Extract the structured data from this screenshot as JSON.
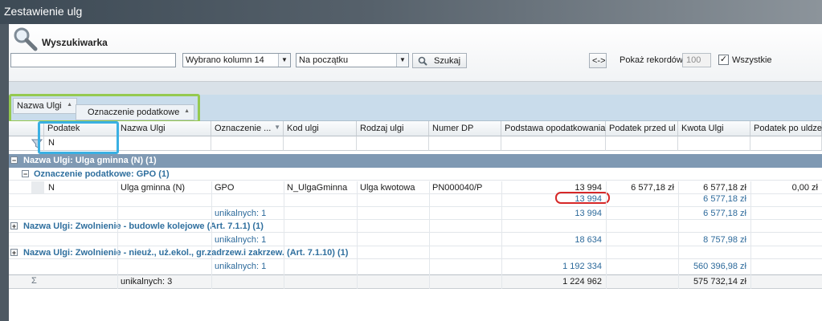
{
  "window": {
    "title": "Zestawienie ulg"
  },
  "search": {
    "panel_title": "Wyszukiwarka",
    "query": "",
    "columns_combo": "Wybrano kolumn 14",
    "mode_combo": "Na początku",
    "search_button": "Szukaj",
    "swap_button": "<->",
    "records_label": "Pokaż rekordów",
    "records_value": "100",
    "all_checked": true,
    "all_label": "Wszystkie"
  },
  "group_by": [
    "Nazwa Ulgi",
    "Oznaczenie podatkowe"
  ],
  "columns": [
    "Podatek",
    "Nazwa Ulgi",
    "Oznaczenie ...",
    "Kod ulgi",
    "Rodzaj ulgi",
    "Numer DP",
    "Podstawa opodatkowania",
    "Podatek przed ul",
    "Kwota Ulgi",
    "Podatek po uldze"
  ],
  "filter": {
    "podatek": "N"
  },
  "groups": [
    {
      "header": "Nazwa Ulgi:  Ulga gminna (N)  (1)",
      "subgroup": {
        "header": "Oznaczenie podatkowe:  GPO  (1)",
        "row": {
          "podatek": "N",
          "nazwa": "Ulga gminna (N)",
          "oznaczenie": "GPO",
          "kod": "N_UlgaGminna",
          "rodzaj": "Ulga kwotowa",
          "numer": "PN000040/P",
          "podstawa": "13 994",
          "przed": "6 577,18 zł",
          "kwota": "6 577,18 zł",
          "po": "0,00 zł"
        },
        "subtotal_podstawa": "13 994",
        "subtotal_kwota": "6 577,18 zł"
      },
      "summary": {
        "unikalnych": "unikalnych: 1",
        "podstawa": "13 994",
        "kwota": "6 577,18 zł"
      }
    },
    {
      "header": "Nazwa Ulgi:  Zwolnienie - budowle kolejowe (Art. 7.1.1)  (1)",
      "summary": {
        "unikalnych": "unikalnych: 1",
        "podstawa": "18 634",
        "kwota": "8 757,98 zł"
      }
    },
    {
      "header": "Nazwa Ulgi:  Zwolnienie - nieuż., uż.ekol., gr.zadrzew.i zakrzew. (Art. 7.1.10)  (1)",
      "summary": {
        "unikalnych": "unikalnych: 1",
        "podstawa": "1 192 334",
        "kwota": "560 396,98 zł"
      }
    }
  ],
  "total": {
    "sigma": "Σ",
    "unikalnych": "unikalnych: 3",
    "podstawa": "1 224 962",
    "kwota": "575 732,14 zł"
  },
  "colors": {
    "accent_green": "#95c950",
    "accent_blue": "#3ab0e3",
    "highlight_red": "#d62828",
    "group_text": "#2f6f9e"
  }
}
